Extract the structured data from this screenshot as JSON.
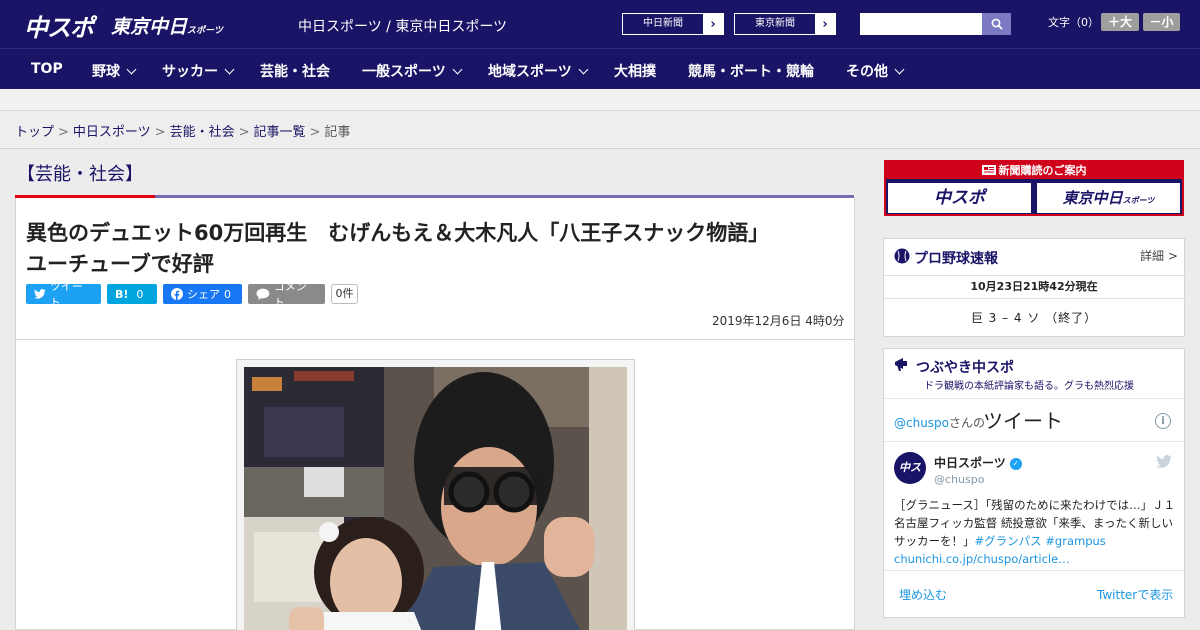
{
  "header": {
    "logo_chuspo": "中スポ",
    "logo_tokyo": "東京中日",
    "logo_tokyo_small": "スポーツ",
    "site_names": "中日スポーツ / 東京中日スポーツ",
    "ext_links": [
      {
        "label": "中日新聞"
      },
      {
        "label": "東京新聞"
      }
    ],
    "search_placeholder": "",
    "font_size_label": "文字（0）",
    "size_up": "＋大",
    "size_down": "－小"
  },
  "nav": {
    "items": [
      {
        "label": "TOP"
      },
      {
        "label": "野球"
      },
      {
        "label": "サッカー"
      },
      {
        "label": "芸能・社会"
      },
      {
        "label": "一般スポーツ"
      },
      {
        "label": "地域スポーツ"
      },
      {
        "label": "大相撲"
      },
      {
        "label": "競馬・ボート・競輪"
      },
      {
        "label": "その他"
      }
    ]
  },
  "breadcrumb": {
    "items": [
      "トップ",
      "中日スポーツ",
      "芸能・社会",
      "記事一覧"
    ],
    "current": "記事",
    "separator": ">"
  },
  "article": {
    "category": "【芸能・社会】",
    "headline_line1": "異色のデュエット60万回再生　むげんもえ＆大木凡人「八王子スナック物語」",
    "headline_line2": "ユーチューブで好評",
    "share": {
      "tweet": "ツイート",
      "hatena_mark": "B!",
      "hatena_count": "0",
      "facebook": "シェア",
      "facebook_count": "0",
      "comment": "コメント",
      "comment_count": "0件"
    },
    "date": "2019年12月6日 4時0分"
  },
  "sidebar": {
    "ad_top": "新聞購読のご案内",
    "ad_left": "中スポ",
    "ad_right": "東京中日",
    "ad_right_small": "スポーツ",
    "baseball_title": "プロ野球速報",
    "baseball_detail": "詳細 >",
    "baseball_time": "10月23日21時42分現在",
    "baseball_score": "巨 3 – 4 ソ （終了）",
    "tweets_title": "つぶやき中スポ",
    "tweets_sub": "ドラ観戦の本紙評論家も語る。グラも熱烈応援",
    "handle": "@chuspo",
    "handle_suffix": "さんの",
    "tweet_word": "ツイート",
    "info_mark": "i",
    "avatar_text": "中スポ",
    "tweet_name": "中日スポーツ",
    "verified_mark": "✓",
    "tweet_screen": "@chuspo",
    "tweet_text_1": "［グラニュース］「残留のために来たわけでは…」Ｊ１名古屋フィッカ監督 続投意欲「来季、まったく新しいサッカーを！」",
    "tweet_tag_1": "#グランパス",
    "tweet_tag_2": "#grampus",
    "tweet_link": "chunichi.co.jp/chuspo/article…",
    "embed": "埋め込む",
    "view_on_twitter": "Twitterで表示"
  },
  "colors": {
    "brand_navy": "#1a1466",
    "accent_red": "#e60012",
    "accent_purple": "#7a6cb4",
    "twitter_blue": "#1da1f2"
  }
}
